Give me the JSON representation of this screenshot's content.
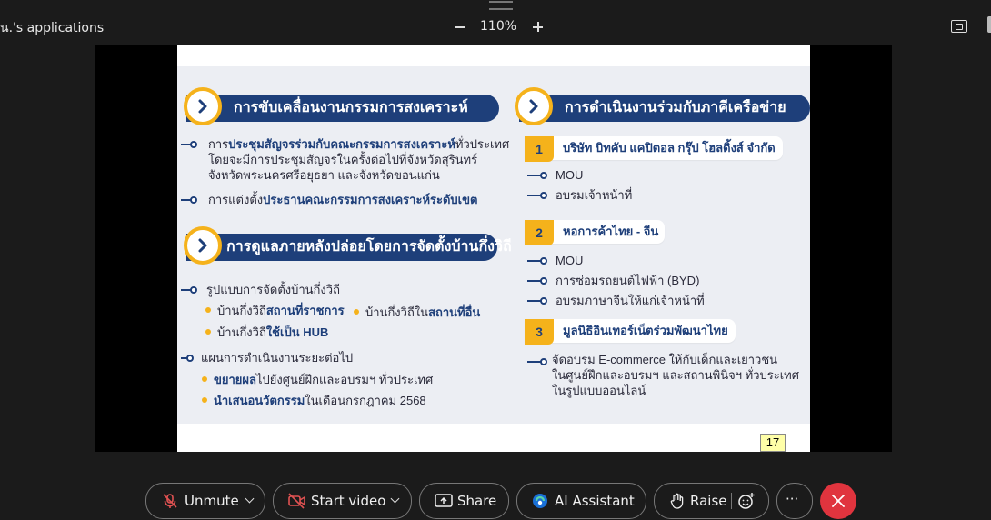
{
  "app": {
    "title": "น.'s applications"
  },
  "zoom": {
    "level": "110%"
  },
  "slide": {
    "page_number": "17",
    "left_sections": [
      {
        "heading": "การขับเคลื่อนงานกรรมการสงเคราะห์",
        "items": [
          {
            "line1_pre": "การ",
            "line1_hl": "ประชุมสัญจรร่วมกับคณะกรรมการสงเคราะห์",
            "line1_post": "ทั่วประเทศ",
            "line2": "โดยจะมีการประชุมสัญจรในครั้งต่อไปที่จังหวัดสุรินทร์",
            "line3": "จังหวัดพระนครศรีอยุธยา และจังหวัดขอนแก่น"
          },
          {
            "pre": "การแต่งตั้ง",
            "hl": "ประธานคณะกรรมการสงเคราะห์ระดับเขต"
          }
        ]
      },
      {
        "heading": "การดูแลภายหลังปล่อยโดยการจัดตั้งบ้านกึ่งวิถี",
        "model_title": "รูปแบบการจัดตั้งบ้านกึ่งวิถี",
        "model_items": [
          {
            "pre": "บ้านกึ่งวิถี",
            "hl": "สถานที่ราชการ"
          },
          {
            "pre": "บ้านกึ่งวิถีใน",
            "hl": "สถานที่อื่น"
          },
          {
            "pre": "บ้านกึ่งวิถี",
            "hl": "ใช้เป็น HUB"
          }
        ],
        "plan_title": "แผนการดำเนินงานระยะต่อไป",
        "plan_items": [
          {
            "hl": "ขยายผล",
            "post": "ไปยังศูนย์ฝึกและอบรมฯ ทั่วประเทศ"
          },
          {
            "hl": "นำเสนอนวัตกรรม",
            "post": "ในเดือนกรกฎาคม 2568"
          }
        ]
      }
    ],
    "right_section": {
      "heading": "การดำเนินงานร่วมกับภาคีเครือข่าย",
      "partners": [
        {
          "num": "1",
          "name": "บริษัท บิทคับ แคปิตอล กรุ๊ป โฮลดิ้งส์ จำกัด",
          "items": [
            "MOU",
            "อบรมเจ้าหน้าที่"
          ]
        },
        {
          "num": "2",
          "name": "หอการค้าไทย - จีน",
          "items": [
            "MOU",
            "การซ่อมรถยนต์ไฟฟ้า (BYD)",
            "อบรมภาษาจีนให้แก่เจ้าหน้าที่"
          ]
        },
        {
          "num": "3",
          "name": "มูลนิธิอินเทอร์เน็ตร่วมพัฒนาไทย",
          "items": [
            "จัดอบรม E-commerce ให้กับเด็กและเยาวชน",
            "ในศูนย์ฝึกและอบรมฯ และสถานพินิจฯ ทั่วประเทศ",
            "ในรูปแบบออนไลน์"
          ]
        }
      ]
    }
  },
  "toolbar": {
    "unmute": "Unmute",
    "start_video": "Start video",
    "share": "Share",
    "ai_assistant": "AI Assistant",
    "raise": "Raise",
    "more": "···"
  },
  "colors": {
    "navy": "#1e3f7a",
    "gold": "#f5b21b",
    "end_call": "#e0343e"
  }
}
